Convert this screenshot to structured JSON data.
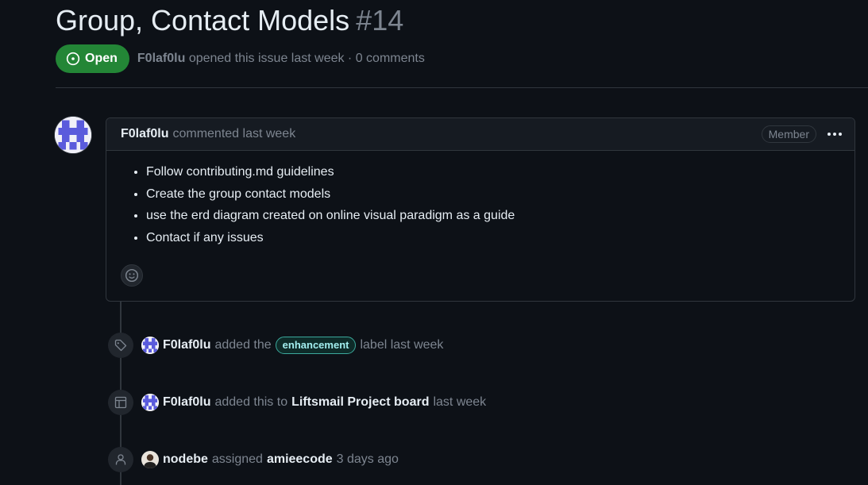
{
  "issue": {
    "title": "Group, Contact Models",
    "number": "#14",
    "state": "Open",
    "author": "F0laf0lu",
    "opened_text": "opened this issue last week · 0 comments"
  },
  "comment": {
    "author": "F0laf0lu",
    "time": "commented last week",
    "role": "Member",
    "items": [
      "Follow contributing.md guidelines",
      "Create the group contact models",
      "use the erd diagram created on online visual paradigm as a guide",
      "Contact if any issues"
    ]
  },
  "events": [
    {
      "icon": "tag-icon",
      "actor": "F0laf0lu",
      "action": "added the",
      "label": "enhancement",
      "suffix": "label last week"
    },
    {
      "icon": "project-icon",
      "actor": "F0laf0lu",
      "action": "added this to",
      "target": "Liftsmail Project board",
      "suffix": "last week"
    },
    {
      "icon": "person-icon",
      "actor": "nodebe",
      "action": "assigned",
      "target": "amieecode",
      "suffix": "3 days ago"
    }
  ],
  "colors": {
    "background": "#0d1117",
    "open_badge": "#238636",
    "label_border": "#3ba99c",
    "label_text": "#a2eeef",
    "avatar_blue": "#5a5bdc"
  }
}
